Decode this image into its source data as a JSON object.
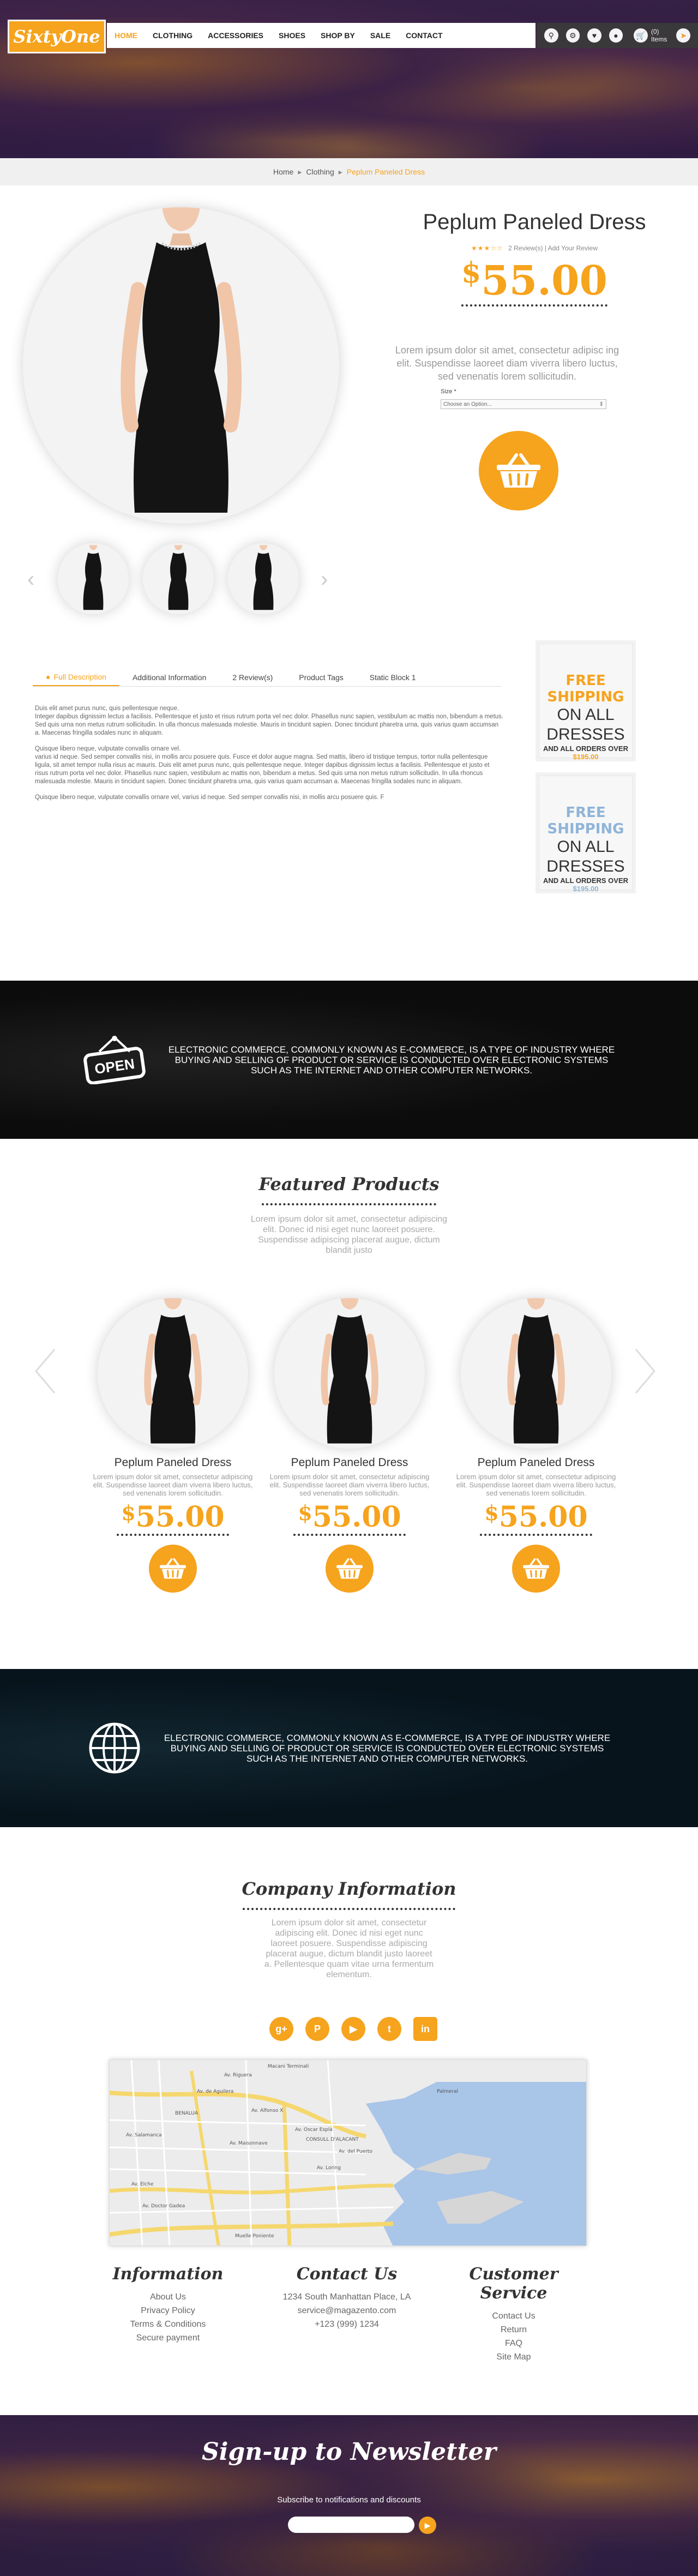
{
  "brand": {
    "logo": "SixtyOne",
    "accent": "#f6a31d"
  },
  "nav": {
    "items": [
      "HOME",
      "CLOTHING",
      "ACCESSORIES",
      "SHOES",
      "SHOP BY",
      "SALE",
      "CONTACT"
    ],
    "active": "HOME"
  },
  "header_tools": {
    "icons": [
      "search-icon",
      "settings-icon",
      "heart-icon",
      "account-icon",
      "cart-icon",
      "order-icon"
    ],
    "cart_label": "(0) Items"
  },
  "breadcrumb": {
    "home": "Home",
    "parent": "Clothing",
    "current": "Peplum Paneled Dress"
  },
  "product": {
    "name": "Peplum Paneled Dress",
    "rating": 3,
    "stars_max": 5,
    "reviews_label": "2 Review(s)",
    "add_review": "Add Your Review",
    "price_symbol": "$",
    "price_value": "55.00",
    "short_desc": "Lorem ipsum dolor sit amet, consectetur adipisc ing elit. Suspendisse laoreet diam viverra libero luctus, sed venenatis lorem sollicitudin.",
    "size_label": "Size *",
    "size_select": "Choose an Option..."
  },
  "tabs": [
    {
      "label": "Full Description",
      "active": true
    },
    {
      "label": "Additional Information",
      "active": false
    },
    {
      "label": "2 Review(s)",
      "active": false
    },
    {
      "label": "Product Tags",
      "active": false
    },
    {
      "label": "Static Block 1",
      "active": false
    }
  ],
  "description": {
    "p1_head": "Duis elit amet purus nunc, quis pellentesque neque.",
    "p1": "Integer dapibus dignissim lectus a facilisis. Pellentesque et justo et risus rutrum porta vel nec dolor. Phasellus nunc sapien, vestibulum ac mattis non, bibendum a metus. Sed quis urna non metus rutrum sollicitudin. In ulla rhoncus malesuada molestie. Mauris in tincidunt sapien. Donec tincidunt pharetra urna, quis varius quam accumsan a. Maecenas fringilla sodales nunc in aliquam.",
    "p2_head": "Quisque libero neque, vulputate convallis ornare vel.",
    "p2": "varius id neque. Sed semper convallis nisi, in mollis arcu posuere quis. Fusce et dolor augue magna. Sed mattis, libero id tristique tempus, tortor nulla pellentesque ligula, sit amet tempor nulla risus ac mauris. Duis elit amet purus nunc, quis pellentesque neque. Integer dapibus dignissim lectus a facilisis. Pellentesque et justo et risus rutrum porta vel nec dolor. Phasellus nunc sapien, vestibulum ac mattis non, bibendum a metus. Sed quis urna non metus rutrum sollicitudin. In ulla rhoncus malesuada molestie. Mauris in tincidunt sapien. Donec tincidunt pharetra urna, quis varius quam accumsan a. Maecenas fringilla sodales nunc in aliquam.",
    "p3": "Quisque libero neque, vulputate convallis ornare vel, varius id neque. Sed semper convallis nisi, in mollis arcu posuere quis. F"
  },
  "promos": [
    {
      "line1": "FREE SHIPPING",
      "line2": "ON ALL DRESSES",
      "line3": "AND ALL ORDERS OVER",
      "amount": "$195.00",
      "color": "#f6a31d"
    },
    {
      "line1": "FREE SHIPPING",
      "line2": "ON ALL DRESSES",
      "line3": "AND ALL ORDERS OVER",
      "amount": "$195.00",
      "color": "#8fb4d8"
    }
  ],
  "band": {
    "text": "ELECTRONIC COMMERCE, COMMONLY KNOWN AS E-COMMERCE, IS A TYPE OF INDUSTRY WHERE BUYING AND SELLING OF PRODUCT OR SERVICE IS CONDUCTED OVER ELECTRONIC SYSTEMS SUCH AS THE INTERNET AND OTHER COMPUTER NETWORKS.",
    "sign": "OPEN"
  },
  "featured": {
    "title": "Featured Products",
    "subtitle": "Lorem ipsum dolor sit amet, consectetur adipiscing elit. Donec id nisi eget nunc laoreet posuere. Suspendisse adipiscing placerat augue, dictum blandit justo",
    "items": [
      {
        "name": "Peplum Paneled Dress",
        "desc": "Lorem ipsum dolor sit amet, consectetur adipiscing elit. Suspendisse laoreet diam viverra libero luctus, sed venenatis lorem sollicitudin.",
        "price": "55.00"
      },
      {
        "name": "Peplum Paneled Dress",
        "desc": "Lorem ipsum dolor sit amet, consectetur adipiscing elit. Suspendisse laoreet diam viverra libero luctus, sed venenatis lorem sollicitudin.",
        "price": "55.00"
      },
      {
        "name": "Peplum Paneled Dress",
        "desc": "Lorem ipsum dolor sit amet, consectetur adipiscing elit. Suspendisse laoreet diam viverra libero luctus, sed venenatis lorem sollicitudin.",
        "price": "55.00"
      }
    ]
  },
  "company": {
    "title": "Company Information",
    "subtitle": "Lorem ipsum dolor sit amet, consectetur adipiscing elit. Donec id nisi eget nunc laoreet posuere. Suspendisse adipiscing placerat augue, dictum blandit justo laoreet a. Pellentesque quam vitae urna fermentum elementum.",
    "social": [
      "g+",
      "p",
      "yt",
      "t",
      "in"
    ]
  },
  "map": {
    "labels": [
      "Macani Terminali",
      "Av. Riguera",
      "BENALUA",
      "Av. Salamanca",
      "Av. Maisonnave",
      "Av. Oscar Esplá",
      "Av. Loring",
      "Av. Elche",
      "Av. de Aguilera",
      "Av. Alfonso X",
      "Av. del Puerto",
      "CONSULL D'ALACANT",
      "Av. Doctor Gadea",
      "Muelle Poniente",
      "Palmeral"
    ]
  },
  "footer": {
    "information": {
      "title": "Information",
      "items": [
        "About Us",
        "Privacy Policy",
        "Terms & Conditions",
        "Secure payment"
      ]
    },
    "contact": {
      "title": "Contact Us",
      "items": [
        "1234 South Manhattan Place, LA",
        "service@magazento.com",
        "+123 (999) 1234"
      ]
    },
    "service": {
      "title": "Customer Service",
      "items": [
        "Contact Us",
        "Return",
        "FAQ",
        "Site Map"
      ]
    }
  },
  "newsletter": {
    "title": "Sign-up to Newsletter",
    "subtitle": "Subscribe to notifications and discounts",
    "placeholder": ""
  }
}
